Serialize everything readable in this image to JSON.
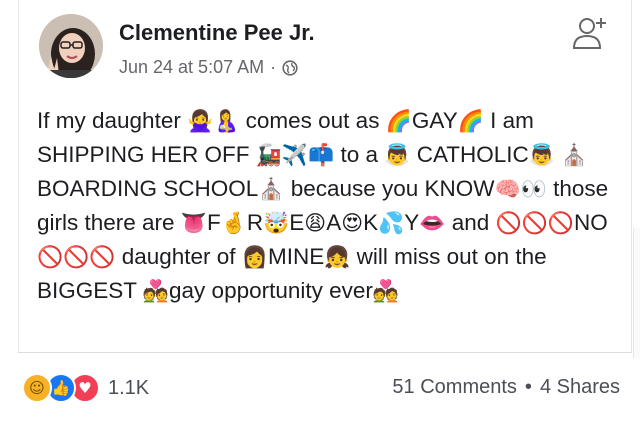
{
  "post": {
    "author": "Clementine Pee Jr.",
    "timestamp": "Jun 24 at 5:07 AM",
    "separator": "·",
    "privacy_icon": "globe-icon",
    "action_icon": "add-friend-icon",
    "text": [
      {
        "t": "If my daughter "
      },
      {
        "e": "🙅‍♀️🤱"
      },
      {
        "t": " comes out as "
      },
      {
        "e": "🌈"
      },
      {
        "t": "GAY"
      },
      {
        "e": "🌈"
      },
      {
        "t": " I am SHIPPING HER OFF "
      },
      {
        "e": "🚂✈️📫"
      },
      {
        "t": " to a "
      },
      {
        "e": "👼"
      },
      {
        "t": " CATHOLIC"
      },
      {
        "e": "👼"
      },
      {
        "t": " "
      },
      {
        "e": "⛪"
      },
      {
        "t": "BOARDING SCHOOL"
      },
      {
        "e": "⛪"
      },
      {
        "t": " because you KNOW"
      },
      {
        "e": "🧠👀"
      },
      {
        "t": " those girls there are "
      },
      {
        "e": "👅"
      },
      {
        "t": "F"
      },
      {
        "e": "🤞"
      },
      {
        "t": "R"
      },
      {
        "e": "🤯"
      },
      {
        "t": "E"
      },
      {
        "e": "😩"
      },
      {
        "t": "A"
      },
      {
        "e": "😍"
      },
      {
        "t": "K"
      },
      {
        "e": "💦"
      },
      {
        "t": "Y"
      },
      {
        "e": "👄"
      },
      {
        "t": " and "
      },
      {
        "e": "🚫🚫🚫"
      },
      {
        "t": "NO"
      },
      {
        "e": "🚫🚫🚫"
      },
      {
        "t": " daughter of "
      },
      {
        "e": "👩"
      },
      {
        "t": "MINE"
      },
      {
        "e": "👧"
      },
      {
        "t": " will miss out on the BIGGEST "
      },
      {
        "e": "💑"
      },
      {
        "t": "gay opportunity ever"
      },
      {
        "e": "💑"
      }
    ]
  },
  "footer": {
    "reaction_icons": [
      "haha-icon",
      "like-icon",
      "love-icon"
    ],
    "reaction_count": "1.1K",
    "comments": "51 Comments",
    "separator": "•",
    "shares": "4 Shares"
  }
}
